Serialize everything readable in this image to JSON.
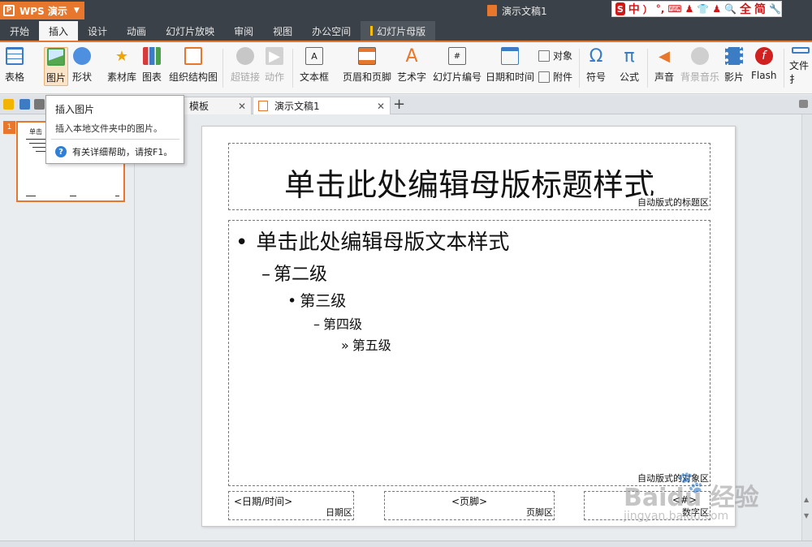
{
  "titlebar": {
    "app_button": "WPS 演示",
    "app_logo": "P",
    "document_title": "演示文稿1",
    "ime": [
      "中",
      "）",
      "°,",
      "⌨",
      "♟",
      "👕",
      "♟",
      "🔍",
      "全",
      "简",
      "🔧"
    ]
  },
  "menu": [
    "开始",
    "插入",
    "设计",
    "动画",
    "幻灯片放映",
    "审阅",
    "视图",
    "办公空间",
    "幻灯片母版"
  ],
  "ribbon": {
    "table": "表格",
    "picture": "图片",
    "shape": "形状",
    "material": "素材库",
    "chart": "图表",
    "org_chart": "组织结构图",
    "hyperlink": "超链接",
    "action": "动作",
    "textbox": "文本框",
    "header_footer": "页眉和页脚",
    "wordart": "艺术字",
    "slide_number": "幻灯片编号",
    "date_time": "日期和时间",
    "object": "对象",
    "attachment": "附件",
    "symbol": "符号",
    "formula": "公式",
    "sound": "声音",
    "bg_music": "背景音乐",
    "movie": "影片",
    "flash": "Flash",
    "file": "文件扌"
  },
  "tabs": {
    "template_tab": "模板",
    "doc_tab": "演示文稿1",
    "add": "+"
  },
  "tooltip": {
    "title": "插入图片",
    "description": "插入本地文件夹中的图片。",
    "help": "有关详细帮助，请按F1。"
  },
  "thumbnail": {
    "number": "1",
    "title": "单击"
  },
  "slide": {
    "title": "单击此处编辑母版标题样式",
    "title_tag": "自动版式的标题区",
    "level1": "单击此处编辑母版文本样式",
    "level2": "第二级",
    "level3": "第三级",
    "level4": "第四级",
    "level5": "第五级",
    "body_tag": "自动版式的对象区",
    "date": "<日期/时间>",
    "date_tag": "日期区",
    "footer": "<页脚>",
    "footer_tag": "页脚区",
    "number": "<#>",
    "number_tag": "数字区"
  },
  "watermark": {
    "line1": "Baidu 经验",
    "line2": "jingyan.baidu.com"
  }
}
